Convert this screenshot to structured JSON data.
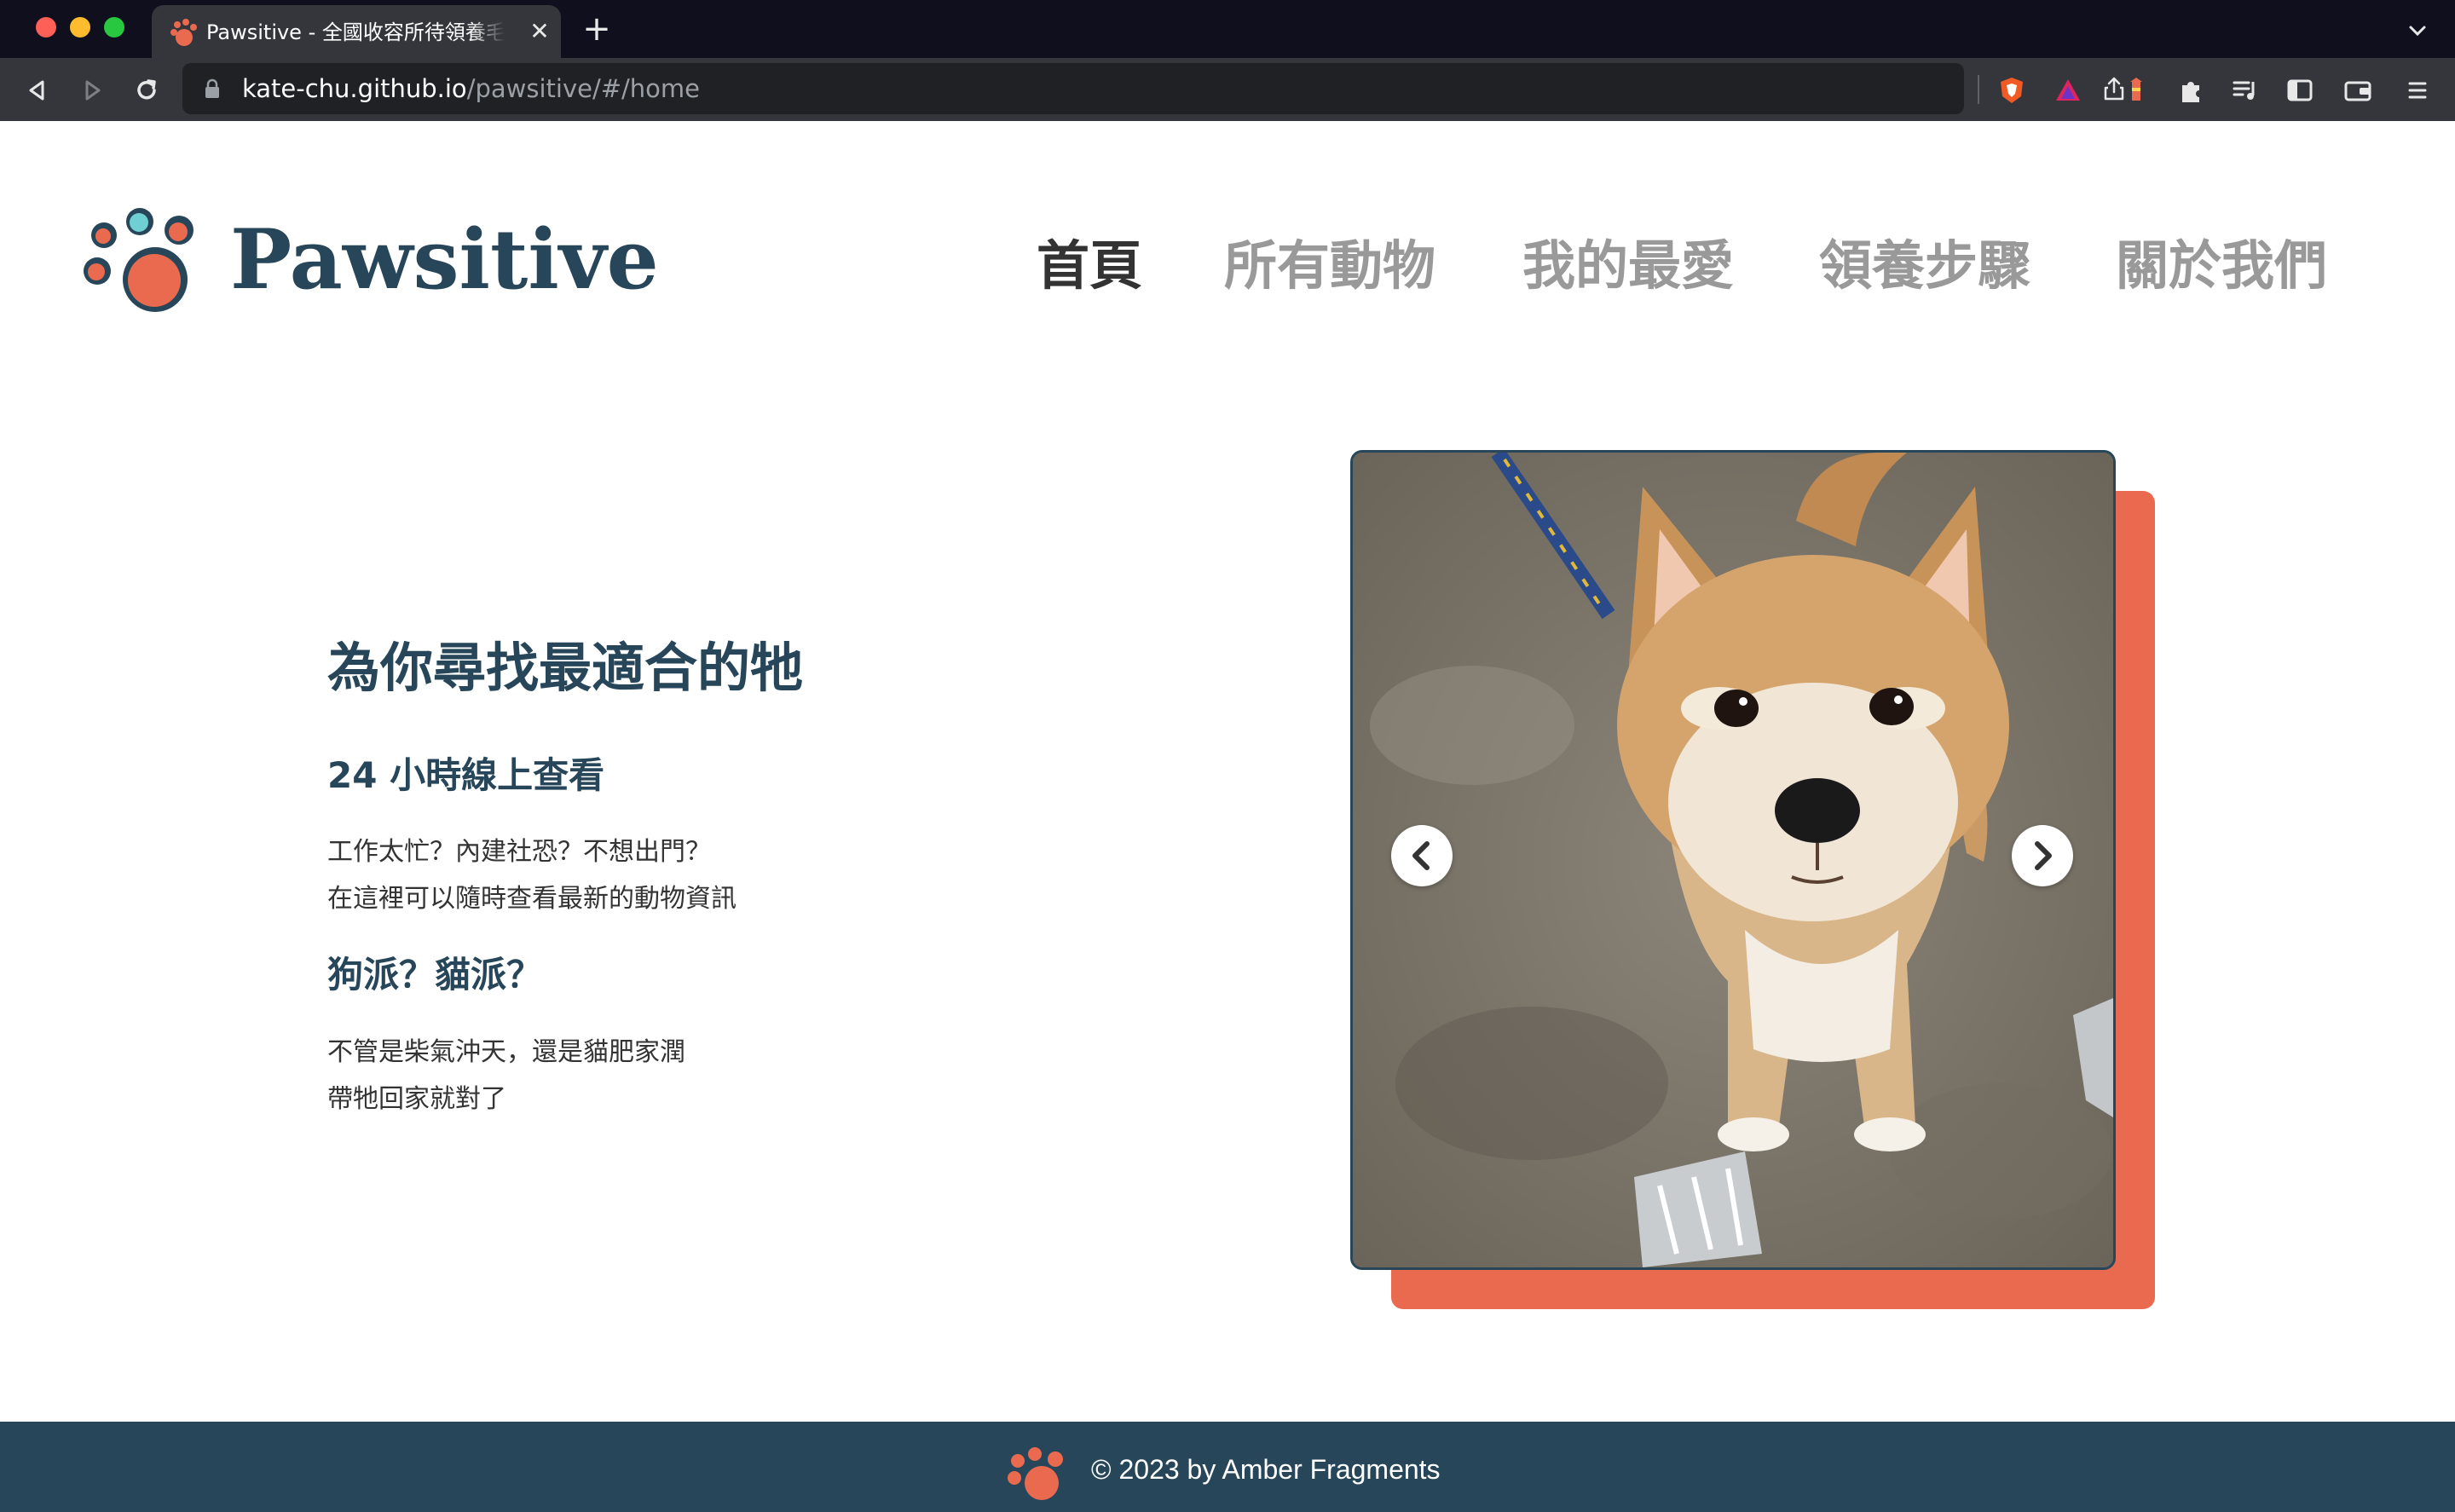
{
  "browser": {
    "tab_title": "Pawsitive - 全國收容所待領養毛孩",
    "new_tab_label": "+",
    "close_label": "✕",
    "url_host": "kate-chu.github.io",
    "url_path": "/pawsitive/#/home"
  },
  "site": {
    "brand": "Pawsitive",
    "nav": [
      {
        "label": "首頁",
        "active": true
      },
      {
        "label": "所有動物",
        "active": false
      },
      {
        "label": "我的最愛",
        "active": false
      },
      {
        "label": "領養步驟",
        "active": false
      },
      {
        "label": "關於我們",
        "active": false
      }
    ],
    "brand_colors": {
      "primary": "#27465a",
      "accent": "#e96a4f",
      "muted": "#999999"
    }
  },
  "hero": {
    "title": "為你尋找最適合的牠",
    "section1": {
      "heading": "24 小時線上查看",
      "lines": [
        "工作太忙？內建社恐？不想出門？",
        "在這裡可以隨時查看最新的動物資訊"
      ]
    },
    "section2": {
      "heading": "狗派？貓派？",
      "lines": [
        "不管是柴氣沖天，還是貓肥家潤",
        "帶牠回家就對了"
      ]
    }
  },
  "carousel": {
    "prev_icon": "chevron-left-icon",
    "next_icon": "chevron-right-icon"
  },
  "footer": {
    "text": "© 2023 by Amber Fragments"
  }
}
